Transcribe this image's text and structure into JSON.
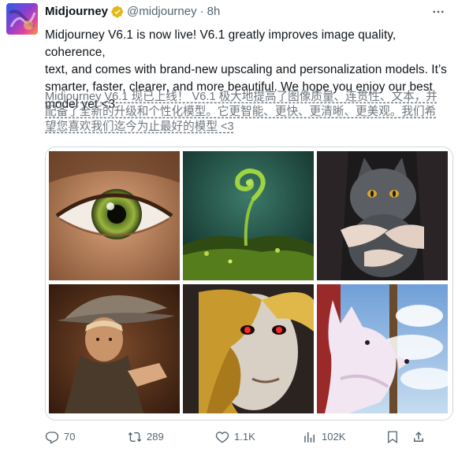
{
  "tweet": {
    "author": {
      "display_name": "Midjourney",
      "handle": "@midjourney",
      "separator": "·",
      "time": "8h",
      "verified": true,
      "verified_color": "#e2b719"
    },
    "text_lines": [
      "Midjourney V6.1 is now live! V6.1 greatly improves image quality, coherence,",
      "text, and comes with brand-new upscaling and personalization models. It’s",
      "smarter, faster, clearer, and more beautiful. We hope you enjoy our best",
      "model yet <3"
    ],
    "translation_lines": [
      "Midjourney V6.1 现已上线！ V6.1 极大地提高了图像质量、连贯性、文本，并",
      "配备了全新的升级和个性化模型。它更智能、更快、更清晰、更美观。我们希",
      "望您喜欢我们迄今为止最好的模型 <3"
    ],
    "media": [
      {
        "icon": "eye-image"
      },
      {
        "icon": "fern-sprout-image"
      },
      {
        "icon": "cat-in-hands-image"
      },
      {
        "icon": "wizard-image"
      },
      {
        "icon": "gold-mask-face-image"
      },
      {
        "icon": "white-wolf-painting-image"
      }
    ],
    "actions": {
      "replies": "70",
      "reposts": "289",
      "likes": "1.1K",
      "views": "102K"
    }
  }
}
